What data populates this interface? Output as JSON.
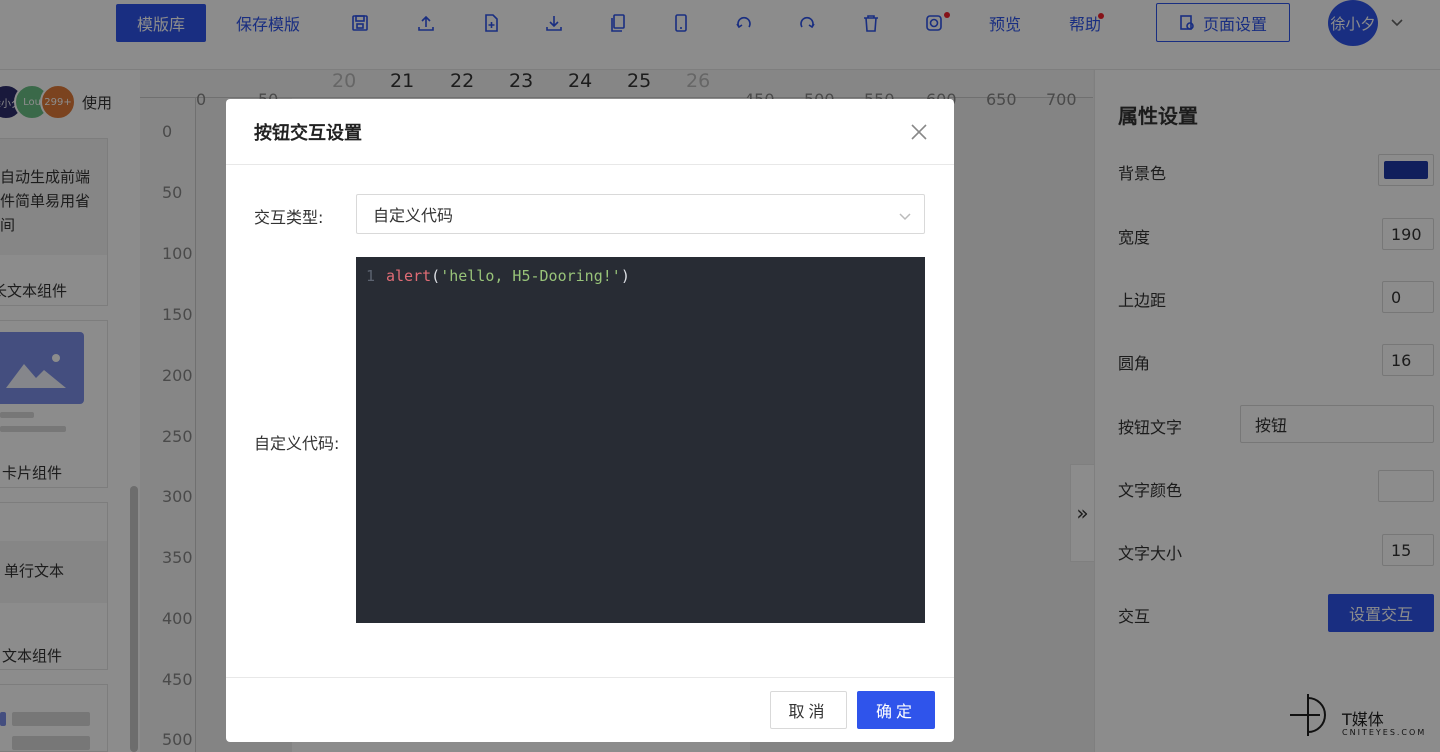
{
  "toolbar": {
    "template_lib": "模版库",
    "save_template": "保存模版",
    "preview": "预览",
    "help": "帮助",
    "page_settings": "页面设置",
    "user_name": "徐小夕",
    "accent": "#2f54eb"
  },
  "left": {
    "user_avatars": [
      "徐小夕",
      "Lou",
      "299+"
    ],
    "use_label": "使用",
    "card1_text": [
      "自动生成前端",
      "件简单易用省",
      "间"
    ],
    "card1_label": "长文本组件",
    "card2_label": "卡片组件",
    "card3_text": "单行文本",
    "card3_label": "文本组件"
  },
  "ruler": {
    "top": [
      "0",
      "50",
      "450",
      "500",
      "550",
      "600",
      "650",
      "700"
    ],
    "dates": [
      "20",
      "21",
      "22",
      "23",
      "24",
      "25",
      "26"
    ],
    "left": [
      "0",
      "50",
      "100",
      "150",
      "200",
      "250",
      "300",
      "350",
      "400",
      "450",
      "500"
    ]
  },
  "props": {
    "title": "属性设置",
    "bg_color_label": "背景色",
    "bg_color": "#1e3aa8",
    "width_label": "宽度",
    "width_value": "190",
    "margin_top_label": "上边距",
    "margin_top_value": "0",
    "radius_label": "圆角",
    "radius_value": "16",
    "btn_text_label": "按钮文字",
    "btn_text_value": "按钮",
    "text_color_label": "文字颜色",
    "font_size_label": "文字大小",
    "font_size_value": "15",
    "interaction_label": "交互",
    "set_interaction": "设置交互",
    "collapse": "»"
  },
  "modal": {
    "title": "按钮交互设置",
    "type_label": "交互类型:",
    "type_value": "自定义代码",
    "code_label": "自定义代码:",
    "line_number": "1",
    "code": {
      "fn": "alert",
      "open": "(",
      "str": "'hello, H5-Dooring!'",
      "close": ")"
    },
    "cancel": "取消",
    "ok": "确定"
  },
  "watermark": {
    "name": "T媒体",
    "sub": "CNITEYES.COM"
  }
}
